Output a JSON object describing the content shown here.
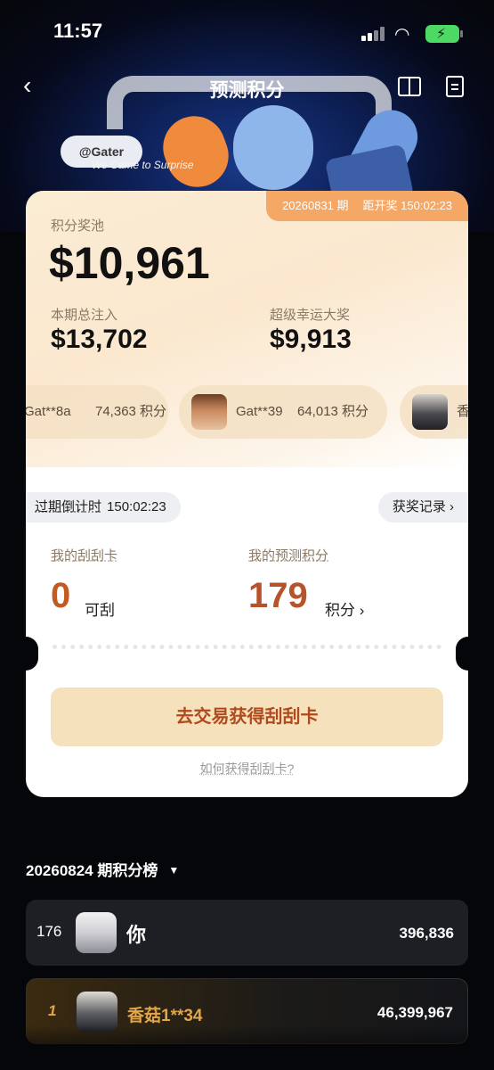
{
  "status_bar": {
    "time": "11:57"
  },
  "nav": {
    "title": "预测积分"
  },
  "hero": {
    "tag": "@Gater",
    "slogan": "We Came to Surprise"
  },
  "pool": {
    "period": "20260831 期",
    "draw_label": "距开奖",
    "draw_countdown": "150:02:23",
    "label": "积分奖池",
    "value": "$10,961",
    "total_label": "本期总注入",
    "total_value": "$13,702",
    "jackpot_label": "超级幸运大奖",
    "jackpot_value": "$9,913"
  },
  "winners": [
    {
      "name": "Gat**8a",
      "points": "74,363 积分"
    },
    {
      "name": "Gat**39",
      "points": "64,013 积分"
    },
    {
      "name": "香"
    }
  ],
  "countdown": {
    "label": "过期倒计时",
    "value": "150:02:23"
  },
  "records_label": "获奖记录",
  "my_cards": {
    "label": "我的刮刮卡",
    "value": "0",
    "unit": "可刮"
  },
  "my_points": {
    "label": "我的预测积分",
    "value": "179",
    "unit": "积分"
  },
  "cta_label": "去交易获得刮刮卡",
  "howto_label": "如何获得刮刮卡?",
  "leaderboard": {
    "title": "20260824 期积分榜",
    "rows": [
      {
        "rank": "176",
        "name": "你",
        "value": "396,836"
      },
      {
        "rank": "1",
        "name": "香菇1**34",
        "value": "46,399,967"
      }
    ]
  },
  "colors": {
    "accent_orange": "#f5a865",
    "points_red": "#b7532a",
    "gold": "#e2a648",
    "battery_green": "#4cd964"
  }
}
